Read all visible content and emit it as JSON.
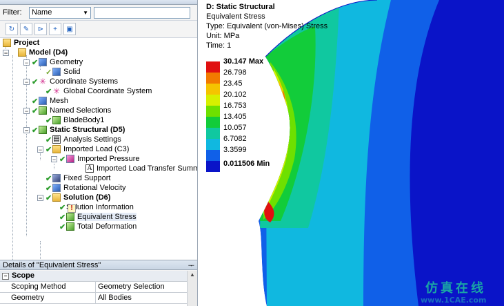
{
  "outline": {
    "filter_label": "Filter:",
    "filter_value": "Name",
    "tree": [
      {
        "label": "Project",
        "bold": true
      },
      {
        "label": "Model (D4)",
        "bold": true
      },
      {
        "label": "Geometry"
      },
      {
        "label": "Solid"
      },
      {
        "label": "Coordinate Systems"
      },
      {
        "label": "Global Coordinate System"
      },
      {
        "label": "Mesh"
      },
      {
        "label": "Named Selections"
      },
      {
        "label": "BladeBody1"
      },
      {
        "label": "Static Structural (D5)",
        "bold": true
      },
      {
        "label": "Analysis Settings"
      },
      {
        "label": "Imported Load (C3)"
      },
      {
        "label": "Imported Pressure"
      },
      {
        "label": "Imported Load Transfer Summa"
      },
      {
        "label": "Fixed Support"
      },
      {
        "label": "Rotational Velocity"
      },
      {
        "label": "Solution (D6)",
        "bold": true
      },
      {
        "label": "Solution Information"
      },
      {
        "label": "Equivalent Stress",
        "selected": true
      },
      {
        "label": "Total Deformation"
      }
    ]
  },
  "details": {
    "title": "Details of \"Equivalent Stress\"",
    "section": "Scope",
    "rows": [
      {
        "name": "Scoping Method",
        "value": "Geometry Selection"
      },
      {
        "name": "Geometry",
        "value": "All Bodies"
      }
    ]
  },
  "viewport": {
    "result_title": "D: Static Structural",
    "result_type": "Equivalent Stress",
    "type_line": "Type: Equivalent (von-Mises) Stress",
    "unit_line": "Unit: MPa",
    "time_line": "Time: 1",
    "legend": [
      {
        "value": "30.147 Max",
        "color": "#e01010"
      },
      {
        "value": "26.798",
        "color": "#f27a00"
      },
      {
        "value": "23.45",
        "color": "#f5c400"
      },
      {
        "value": "20.102",
        "color": "#d7f000"
      },
      {
        "value": "16.753",
        "color": "#6ee000"
      },
      {
        "value": "13.405",
        "color": "#12cc3a"
      },
      {
        "value": "10.057",
        "color": "#10c8a0"
      },
      {
        "value": "6.7082",
        "color": "#10b8e0"
      },
      {
        "value": "3.3599",
        "color": "#1060e8"
      }
    ],
    "legend_min": "0.011506 Min",
    "legend_min_color": "#0a14c8"
  },
  "watermark": {
    "text": "仿真在线",
    "url": "www.1CAE.com"
  }
}
